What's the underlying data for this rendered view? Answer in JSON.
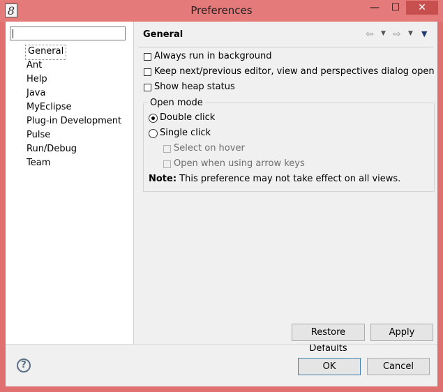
{
  "window": {
    "title": "Preferences",
    "app_icon_glyph": "8",
    "minimize_glyph": "—",
    "maximize_glyph": "☐",
    "close_glyph": "✕"
  },
  "tree": {
    "filter_value": "",
    "items": [
      {
        "label": "General",
        "selected": true
      },
      {
        "label": "Ant"
      },
      {
        "label": "Help"
      },
      {
        "label": "Java"
      },
      {
        "label": "MyEclipse"
      },
      {
        "label": "Plug-in Development"
      },
      {
        "label": "Pulse"
      },
      {
        "label": "Run/Debug"
      },
      {
        "label": "Team"
      }
    ]
  },
  "page": {
    "title": "General",
    "nav_back_glyph": "⇦",
    "nav_forward_glyph": "⇨",
    "nav_dropdown_glyph": "▼",
    "options": {
      "always_run_background": {
        "label": "Always run in background",
        "checked": false
      },
      "keep_next_previous": {
        "label": "Keep next/previous editor, view and perspectives dialog open",
        "checked": false
      },
      "show_heap": {
        "label": "Show heap status",
        "checked": false
      }
    },
    "open_mode": {
      "title": "Open mode",
      "double_click": {
        "label": "Double click",
        "selected": true
      },
      "single_click": {
        "label": "Single click",
        "selected": false
      },
      "select_on_hover": {
        "label": "Select on hover",
        "enabled": false
      },
      "open_arrow_keys": {
        "label": "Open when using arrow keys",
        "enabled": false
      },
      "note_label": "Note:",
      "note_text": " This preference may not take effect on all views."
    },
    "restore_defaults_label": "Restore Defaults",
    "apply_label": "Apply"
  },
  "dialog": {
    "help_glyph": "?",
    "ok_label": "OK",
    "cancel_label": "Cancel"
  }
}
